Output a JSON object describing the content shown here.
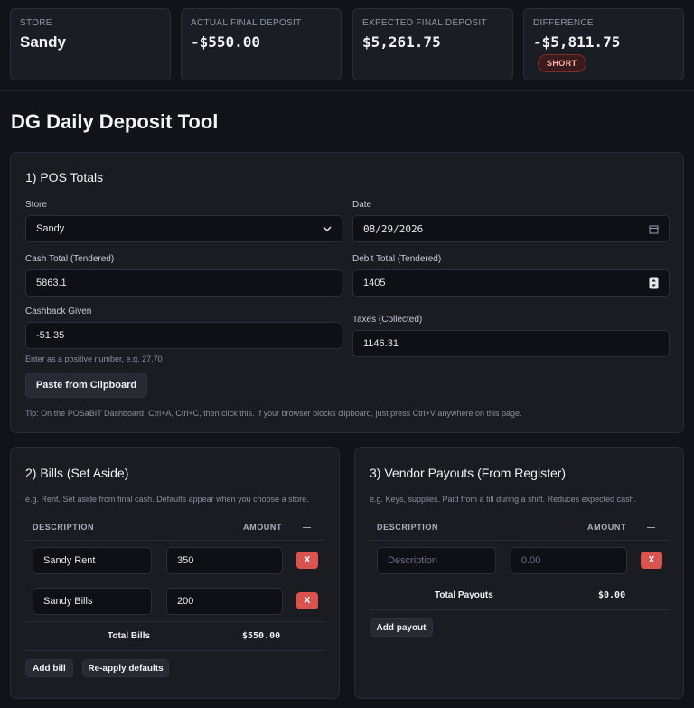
{
  "summary": {
    "store": {
      "label": "STORE",
      "value": "Sandy"
    },
    "actual": {
      "label": "ACTUAL FINAL DEPOSIT",
      "value": "-$550.00"
    },
    "expected": {
      "label": "EXPECTED FINAL DEPOSIT",
      "value": "$5,261.75"
    },
    "difference": {
      "label": "DIFFERENCE",
      "value": "-$5,811.75",
      "badge": "SHORT"
    }
  },
  "page_title": "DG Daily Deposit Tool",
  "pos": {
    "title": "1) POS Totals",
    "store_label": "Store",
    "store_value": "Sandy",
    "date_label": "Date",
    "date_value": "08/29/2026",
    "cash_label": "Cash Total (Tendered)",
    "cash_value": "5863.1",
    "debit_label": "Debit Total (Tendered)",
    "debit_value": "1405",
    "cashback_label": "Cashback Given",
    "cashback_value": "-51.35",
    "cashback_hint": "Enter as a positive number, e.g. 27.70",
    "taxes_label": "Taxes (Collected)",
    "taxes_value": "1146.31",
    "paste_button": "Paste from Clipboard",
    "tip": "Tip: On the POSaBIT Dashboard: Ctrl+A, Ctrl+C, then click this. If your browser blocks clipboard, just press Ctrl+V anywhere on this page."
  },
  "bills": {
    "title": "2) Bills (Set Aside)",
    "hint": "e.g. Rent. Set aside from final cash. Defaults appear when you choose a store.",
    "col_description": "DESCRIPTION",
    "col_amount": "AMOUNT",
    "col_action": "—",
    "rows": [
      {
        "description": "Sandy Rent",
        "amount": "350",
        "remove": "X"
      },
      {
        "description": "Sandy Bills",
        "amount": "200",
        "remove": "X"
      }
    ],
    "total_label": "Total Bills",
    "total_value": "$550.00",
    "add_button": "Add bill",
    "reapply_button": "Re-apply defaults"
  },
  "payouts": {
    "title": "3) Vendor Payouts (From Register)",
    "hint": "e.g. Keys, supplies. Paid from a till during a shift. Reduces expected cash.",
    "col_description": "DESCRIPTION",
    "col_amount": "AMOUNT",
    "col_action": "—",
    "row": {
      "description_placeholder": "Description",
      "amount_placeholder": "0.00",
      "remove": "X"
    },
    "total_label": "Total Payouts",
    "total_value": "$0.00",
    "add_button": "Add payout"
  }
}
